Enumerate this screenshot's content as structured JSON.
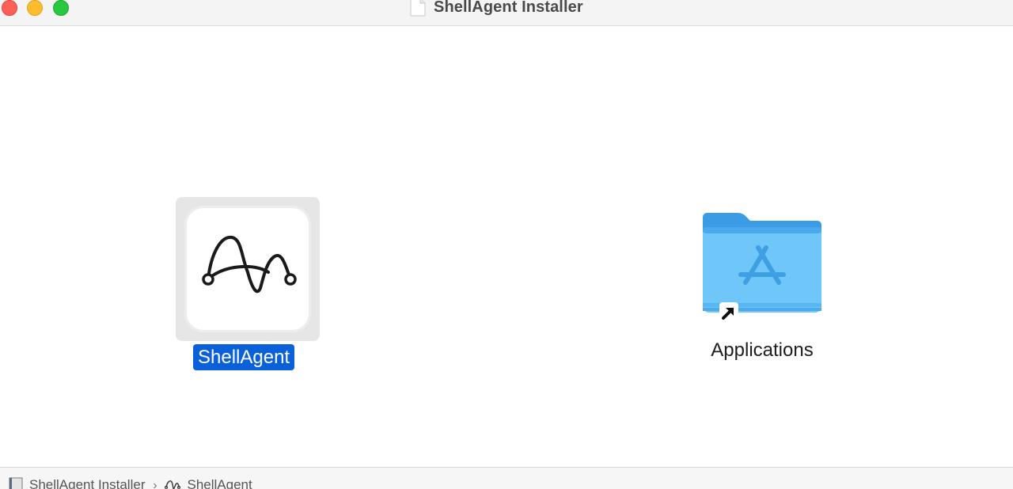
{
  "window": {
    "title": "ShellAgent Installer"
  },
  "items": [
    {
      "label": "ShellAgent",
      "icon": "shellagent-app-icon",
      "selected": true
    },
    {
      "label": "Applications",
      "icon": "applications-folder-alias-icon",
      "selected": false
    }
  ],
  "pathbar": {
    "crumbs": [
      {
        "label": "ShellAgent Installer",
        "icon": "disk-image-icon"
      },
      {
        "label": "ShellAgent",
        "icon": "shellagent-mini-icon"
      }
    ],
    "separator": "›"
  },
  "colors": {
    "selection": "#0a60d8",
    "folder": "#6ec3f7",
    "close": "#fe5f57",
    "minimize": "#febc2e",
    "zoom": "#28c840"
  }
}
